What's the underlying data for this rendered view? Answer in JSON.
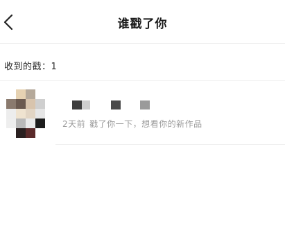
{
  "header": {
    "title": "谁戳了你",
    "back_icon": "chevron-left-icon"
  },
  "summary": {
    "received_label": "收到的戳：1"
  },
  "pokes": [
    {
      "time": "2天前",
      "message": "戳了你一下，想看你的新作品",
      "avatar": "pixelated-avatar",
      "username": "pixelated-username"
    }
  ]
}
